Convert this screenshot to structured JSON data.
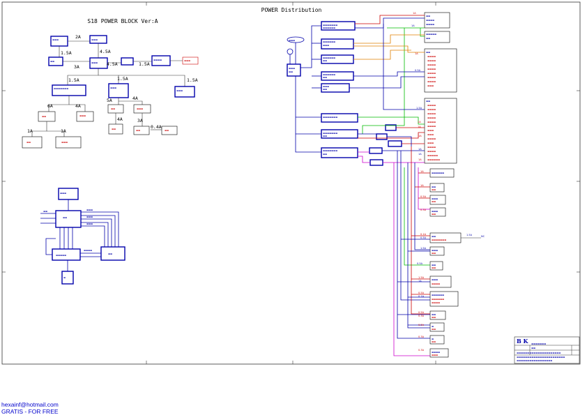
{
  "titles": {
    "main": "POWER Distribution",
    "left": "S18 POWER BLOCK Ver:A"
  },
  "left_block": {
    "currents": [
      "2A",
      "1.5A",
      "4.5A",
      "3A",
      "4.5A",
      "1.5A",
      "1.5A",
      "1.5A",
      "1.5A",
      "5A",
      "4A",
      "6A",
      "4A",
      "4A",
      "3A",
      "0.4A",
      "1A",
      "1A"
    ]
  },
  "right_block": {
    "currents_red": [
      "1A",
      "1A",
      "1A",
      "1A",
      "1A",
      "1A",
      "1A",
      "1A",
      "0.5A",
      "0.3A",
      "0.1A",
      "1.5A",
      "0.5A",
      "0.5A",
      "0.3A",
      "0.5A",
      "0.3A",
      "0.3A"
    ],
    "currents_blue": [
      "1A",
      "0.5A",
      "1.5A",
      "1A",
      "1A",
      "0.5A",
      "1.5A",
      "0.5A",
      "1A",
      "0.1A"
    ],
    "side_value": "1.5A",
    "side_label": "NC"
  },
  "logo": "B K",
  "footer": {
    "email": "hexainf@hotmail.com",
    "note": "GRATIS - FOR FREE"
  },
  "colors": {
    "blue": "#0000aa",
    "red": "#cc0000",
    "green": "#00bb00",
    "orange": "#e08000",
    "magenta": "#cc00cc"
  }
}
